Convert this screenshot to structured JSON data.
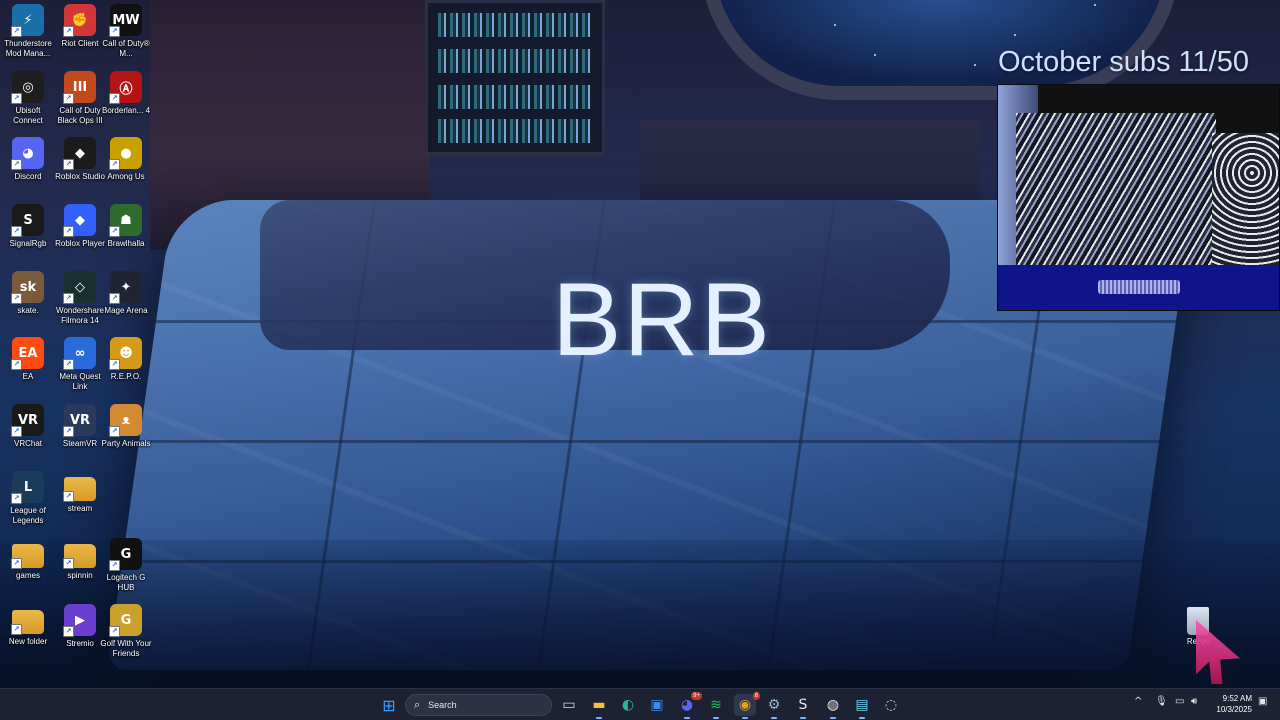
{
  "overlay": {
    "brb_text": "BRB",
    "subs_text": "October subs 11/50"
  },
  "desktop_icons": [
    {
      "label": "Thunderstore Mod Mana...",
      "icon": "thunderstore-icon",
      "color": "#1a6fa8",
      "glyph": "⚡"
    },
    {
      "label": "Riot Client",
      "icon": "riot-client-icon",
      "color": "#d13639",
      "glyph": "✊"
    },
    {
      "label": "Call of Duty® M...",
      "icon": "call-of-duty-mw-icon",
      "color": "#111111",
      "glyph": "MW"
    },
    {
      "label": "Ubisoft Connect",
      "icon": "ubisoft-connect-icon",
      "color": "#1f1f1f",
      "glyph": "◎"
    },
    {
      "label": "Call of Duty Black Ops III",
      "icon": "black-ops-3-icon",
      "color": "#c2491b",
      "glyph": "III"
    },
    {
      "label": "Borderlan... 4",
      "icon": "borderlands-icon",
      "color": "#b31515",
      "glyph": "Ⓐ"
    },
    {
      "label": "Discord",
      "icon": "discord-icon",
      "color": "#5865f2",
      "glyph": "◕"
    },
    {
      "label": "Roblox Studio",
      "icon": "roblox-studio-icon",
      "color": "#1b1b1b",
      "glyph": "◆"
    },
    {
      "label": "Among Us",
      "icon": "among-us-icon",
      "color": "#c8a000",
      "glyph": "●"
    },
    {
      "label": "SignalRgb",
      "icon": "signalrgb-icon",
      "color": "#1a1a1a",
      "glyph": "S"
    },
    {
      "label": "Roblox Player",
      "icon": "roblox-player-icon",
      "color": "#335fff",
      "glyph": "◆"
    },
    {
      "label": "Brawlhalla",
      "icon": "brawlhalla-icon",
      "color": "#2f6b2f",
      "glyph": "☗"
    },
    {
      "label": "skate.",
      "icon": "skate-icon",
      "color": "#7a5a3a",
      "glyph": "sk"
    },
    {
      "label": "Wondershare Filmora 14",
      "icon": "filmora-icon",
      "color": "#16312e",
      "glyph": "◇"
    },
    {
      "label": "Mage Arena",
      "icon": "mage-arena-icon",
      "color": "#1f2533",
      "glyph": "✦"
    },
    {
      "label": "EA",
      "icon": "ea-icon",
      "color": "#ff4a12",
      "glyph": "EA"
    },
    {
      "label": "Meta Quest Link",
      "icon": "meta-quest-link-icon",
      "color": "#2a6bdc",
      "glyph": "∞"
    },
    {
      "label": "R.E.P.O.",
      "icon": "repo-icon",
      "color": "#d69a1a",
      "glyph": "☻"
    },
    {
      "label": "VRChat",
      "icon": "vrchat-icon",
      "color": "#1a1a1a",
      "glyph": "VR"
    },
    {
      "label": "SteamVR",
      "icon": "steamvr-icon",
      "color": "#2a3a5c",
      "glyph": "VR"
    },
    {
      "label": "Party Animals",
      "icon": "party-animals-icon",
      "color": "#d38a32",
      "glyph": "ᴥ"
    },
    {
      "label": "League of Legends",
      "icon": "league-of-legends-icon",
      "color": "#1b3b5a",
      "glyph": "L"
    },
    {
      "label": "stream",
      "icon": "folder-icon",
      "color": "#e8b84a",
      "glyph": ""
    },
    {
      "label": "games",
      "icon": "folder-icon",
      "color": "#e8b84a",
      "glyph": ""
    },
    {
      "label": "spinnin",
      "icon": "folder-icon",
      "color": "#e8b84a",
      "glyph": ""
    },
    {
      "label": "Logitech G HUB",
      "icon": "logitech-g-hub-icon",
      "color": "#111111",
      "glyph": "G"
    },
    {
      "label": "New folder",
      "icon": "folder-icon",
      "color": "#e8b84a",
      "glyph": ""
    },
    {
      "label": "Stremio",
      "icon": "stremio-icon",
      "color": "#6a3fd0",
      "glyph": "▶"
    },
    {
      "label": "Golf With Your Friends",
      "icon": "golf-with-friends-icon",
      "color": "#c8a02a",
      "glyph": "G"
    }
  ],
  "recycle_bin": {
    "label": "Recyc",
    "icon": "recycle-bin-icon"
  },
  "taskbar": {
    "search_placeholder": "Search",
    "apps": [
      {
        "name": "start-button",
        "icon": "windows-start-icon",
        "color": "#3aa0ff",
        "glyph": "⊞"
      },
      {
        "name": "task-view",
        "icon": "task-view-icon",
        "color": "#d8d8d8",
        "glyph": "▭"
      },
      {
        "name": "file-explorer",
        "icon": "file-explorer-icon",
        "color": "#f3c23c",
        "glyph": "▬"
      },
      {
        "name": "edge",
        "icon": "edge-icon",
        "color": "#2bb5a0",
        "glyph": "◐"
      },
      {
        "name": "microsoft-store",
        "icon": "store-icon",
        "color": "#3a8be8",
        "glyph": "▣"
      },
      {
        "name": "discord",
        "icon": "discord-icon",
        "color": "#5865f2",
        "glyph": "◕"
      },
      {
        "name": "spotify",
        "icon": "spotify-icon",
        "color": "#1db954",
        "glyph": "≋"
      },
      {
        "name": "chrome",
        "icon": "chrome-icon",
        "color": "#e0a01a",
        "glyph": "◉"
      },
      {
        "name": "steam",
        "icon": "steam-icon",
        "color": "#9ab4d8",
        "glyph": "⚙"
      },
      {
        "name": "signalrgb",
        "icon": "signalrgb-icon",
        "color": "#e6e6e6",
        "glyph": "S"
      },
      {
        "name": "obs",
        "icon": "obs-icon",
        "color": "#e6e6e6",
        "glyph": "◍"
      },
      {
        "name": "notepad",
        "icon": "notepad-icon",
        "color": "#6cd0f0",
        "glyph": "▤"
      },
      {
        "name": "app-extra",
        "icon": "app-icon",
        "color": "#cfcfcf",
        "glyph": "◌"
      }
    ],
    "discord_badge": "9+",
    "chrome_badge": "8",
    "tray": {
      "chevron": "^",
      "mic_icon": "microphone-icon",
      "network_icon": "network-icon",
      "volume_icon": "volume-icon",
      "battery_icon": "battery-icon"
    },
    "clock_time": "9:52 AM",
    "clock_date": "10/3/2025"
  }
}
